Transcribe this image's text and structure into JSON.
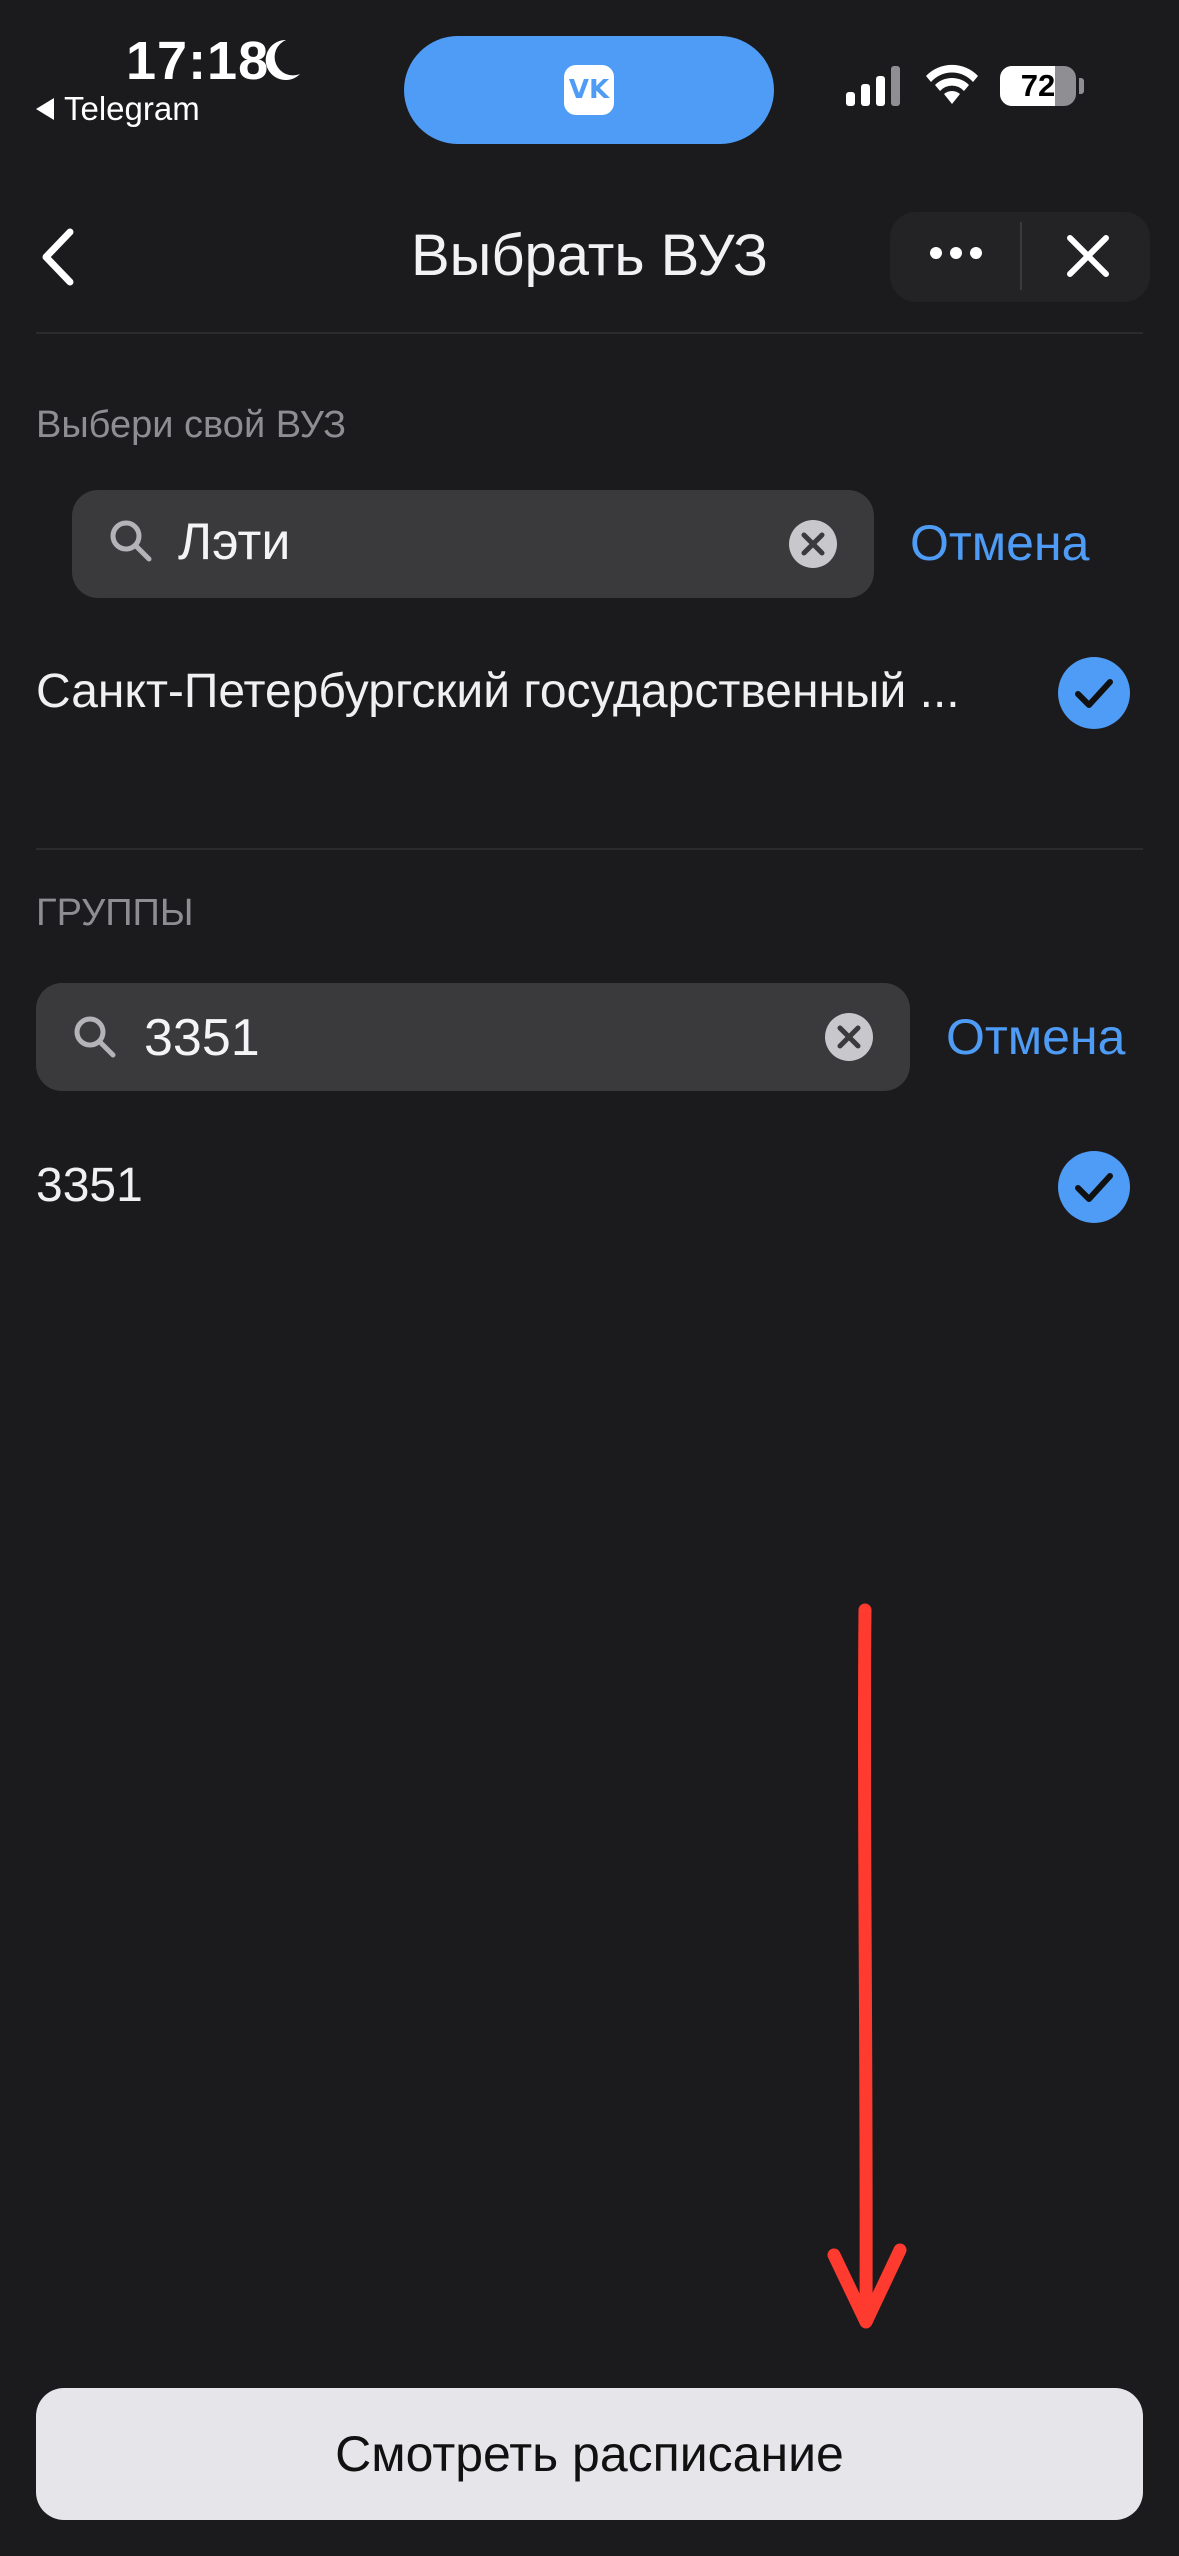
{
  "status_bar": {
    "time": "17:18",
    "back_app": "Telegram",
    "battery": "72",
    "battery_level": 0.72,
    "island_app_icon": "vk-icon"
  },
  "header": {
    "title": "Выбрать ВУЗ",
    "back_icon": "chevron-left-icon",
    "more_icon": "more-dots-icon",
    "close_icon": "close-icon"
  },
  "university": {
    "label": "Выбери свой ВУЗ",
    "search_value": "Лэти",
    "cancel_label": "Отмена",
    "result": "Санкт-Петербургский государственный ..."
  },
  "groups": {
    "label": "ГРУППЫ",
    "search_value": "3351",
    "cancel_label": "Отмена",
    "result": "3351"
  },
  "main_button": {
    "label": "Смотреть расписание"
  },
  "colors": {
    "background": "#1b1b1d",
    "accent": "#4e9cf5",
    "annotation_arrow": "#ff3b30",
    "button_bg": "#e5e5ea"
  }
}
